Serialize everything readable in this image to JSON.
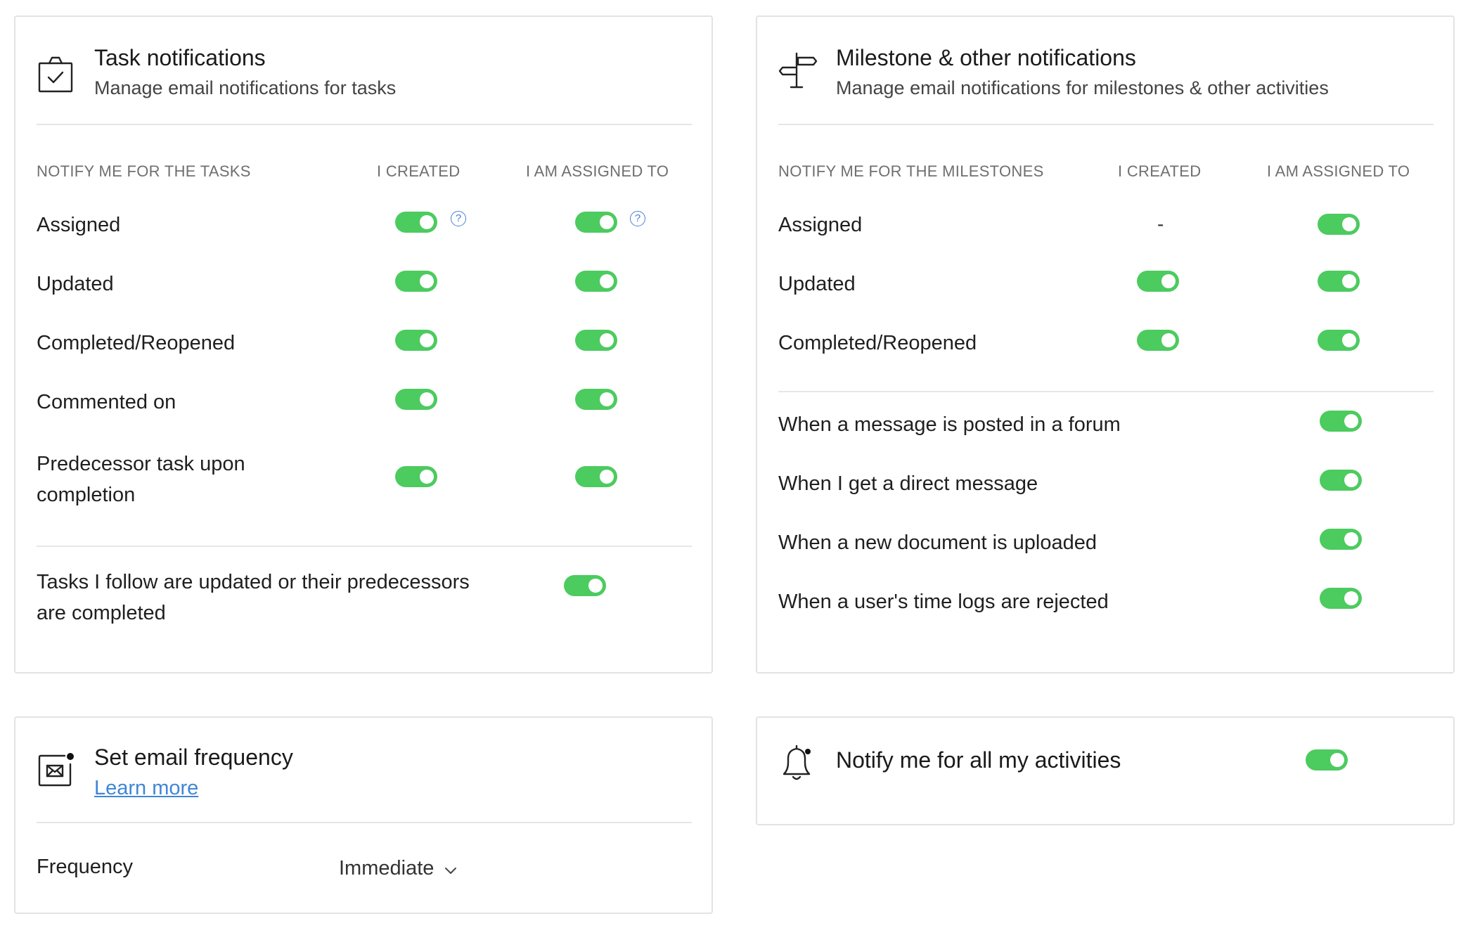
{
  "tasks": {
    "title": "Task notifications",
    "subtitle": "Manage email notifications for tasks",
    "icon": "clipboard-check-icon",
    "col_headers": [
      "NOTIFY ME FOR THE TASKS",
      "I CREATED",
      "I AM ASSIGNED TO"
    ],
    "rows": [
      {
        "label": "Assigned",
        "created": true,
        "assigned": true,
        "help": "?"
      },
      {
        "label": "Updated",
        "created": true,
        "assigned": true
      },
      {
        "label": "Completed/Reopened",
        "created": true,
        "assigned": true
      },
      {
        "label": "Commented on",
        "created": true,
        "assigned": true
      },
      {
        "label": "Predecessor task upon completion",
        "created": true,
        "assigned": true
      }
    ],
    "follow": {
      "label": "Tasks I follow are updated or their predecessors are completed",
      "enabled": true
    }
  },
  "milestones": {
    "title": "Milestone & other notifications",
    "subtitle": "Manage email notifications for milestones & other activities",
    "icon": "signpost-icon",
    "col_headers": [
      "NOTIFY ME FOR THE MILESTONES",
      "I CREATED",
      "I AM ASSIGNED TO"
    ],
    "rows": [
      {
        "label": "Assigned",
        "created_text": "-",
        "assigned": true
      },
      {
        "label": "Updated",
        "created": true,
        "assigned": true
      },
      {
        "label": "Completed/Reopened",
        "created": true,
        "assigned": true
      }
    ],
    "other": [
      {
        "label": "When a message is posted in a forum",
        "enabled": true
      },
      {
        "label": "When I get a direct message",
        "enabled": true
      },
      {
        "label": "When a new document is uploaded",
        "enabled": true
      },
      {
        "label": "When a user's time logs are rejected",
        "enabled": true
      }
    ]
  },
  "frequency": {
    "title": "Set email frequency",
    "link": "Learn more",
    "icon": "email-frequency-icon",
    "label": "Frequency",
    "value": "Immediate"
  },
  "activities": {
    "title": "Notify me for all my activities",
    "icon": "bell-icon",
    "enabled": true
  },
  "colors": {
    "toggle_on": "#4ccb5f",
    "link": "#3f86d6",
    "border": "#e3e3e3"
  }
}
